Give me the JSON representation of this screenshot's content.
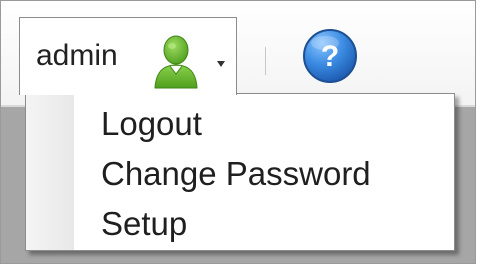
{
  "user_menu": {
    "username": "admin",
    "avatar_icon": "user-icon",
    "caret_icon": "caret-down-icon"
  },
  "help": {
    "icon": "help-icon",
    "glyph": "?"
  },
  "dropdown": {
    "items": [
      {
        "label": "Logout"
      },
      {
        "label": "Change Password"
      },
      {
        "label": "Setup"
      }
    ]
  },
  "colors": {
    "avatar_green": "#6ab82a",
    "help_blue": "#2f79cf",
    "content_gray": "#a6a6a6",
    "border_gray": "#8c8c8c"
  }
}
